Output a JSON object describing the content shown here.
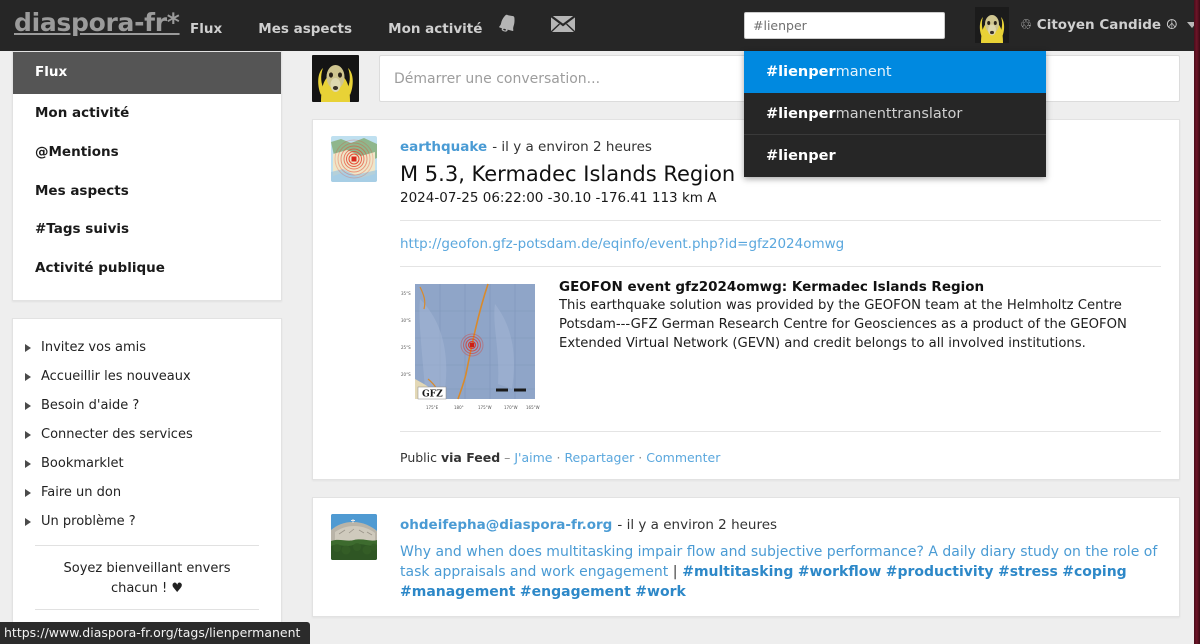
{
  "topnav": {
    "brand": "diaspora-fr*",
    "links": [
      {
        "label": "Flux"
      },
      {
        "label": "Mes aspects"
      },
      {
        "label": "Mon activité"
      }
    ],
    "icons": [
      {
        "name": "bell-icon",
        "glyph": "notifications"
      },
      {
        "name": "envelope-icon",
        "glyph": "messages"
      }
    ],
    "search": {
      "value": "#lienper",
      "placeholder": "#lienper"
    },
    "user": {
      "name": "♲ Citoyen Candide ☮",
      "avatar_alt": "dog in yellow hood avatar"
    }
  },
  "autocomplete": {
    "items": [
      {
        "match": "#lienper",
        "rest": "manent",
        "selected": true
      },
      {
        "match": "#lienper",
        "rest": "manenttranslator",
        "selected": false
      },
      {
        "match": "#lienper",
        "rest": "",
        "selected": false
      }
    ]
  },
  "sidebar": {
    "nav": [
      {
        "label": "Flux",
        "active": true
      },
      {
        "label": "Mon activité",
        "active": false
      },
      {
        "label": "@Mentions",
        "active": false
      },
      {
        "label": "Mes aspects",
        "active": false
      },
      {
        "label": "#Tags suivis",
        "active": false
      },
      {
        "label": "Activité publique",
        "active": false
      }
    ],
    "help": [
      {
        "label": "Invitez vos amis"
      },
      {
        "label": "Accueillir les nouveaux"
      },
      {
        "label": "Besoin d'aide ?"
      },
      {
        "label": "Connecter des services"
      },
      {
        "label": "Bookmarklet"
      },
      {
        "label": "Faire un don"
      },
      {
        "label": "Un problème ?"
      }
    ],
    "kindness": "Soyez bienveillant envers chacun ! ♥"
  },
  "composer": {
    "placeholder": "Démarrer une conversation..."
  },
  "posts": [
    {
      "author": "earthquake",
      "timestamp": "- il y a environ 2 heures",
      "title": "M 5.3, Kermadec Islands Region",
      "subtitle": "2024-07-25 06:22:00 -30.10 -176.41 113 km A",
      "link": "http://geofon.gfz-potsdam.de/eqinfo/event.php?id=gfz2024omwg",
      "preview": {
        "title": "GEOFON event gfz2024omwg: Kermadec Islands Region",
        "description": "This earthquake solution was provided by the GEOFON team at the Helmholtz Centre Potsdam---GFZ German Research Centre for Geosciences as a product of the GEOFON Extended Virtual Network (GEVN) and credit belongs to all involved institutions.",
        "map_label": "GFZ"
      },
      "footer": {
        "visibility": "Public",
        "via": "via Feed",
        "dash": "–",
        "like": "J'aime",
        "reshare": "Repartager",
        "comment": "Commenter"
      }
    },
    {
      "author": "ohdeifepha@diaspora-fr.org",
      "timestamp": "- il y a environ 2 heures",
      "body_link": "Why and when does multitasking impair flow and subjective performance? A daily diary study on the role of task appraisals and work engagement",
      "pipe": "|",
      "tags": [
        "#multitasking",
        "#workflow",
        "#productivity",
        "#stress",
        "#coping",
        "#management",
        "#engagement",
        "#work"
      ]
    }
  ],
  "statusbar": {
    "url": "https://www.diaspora-fr.org/tags/lienpermanent"
  },
  "colors": {
    "nav_bg": "#262626",
    "accent_blue": "#0089e0",
    "link_blue": "#4a9bd4",
    "page_bg": "#eeeeee",
    "active_nav": "#555555"
  }
}
